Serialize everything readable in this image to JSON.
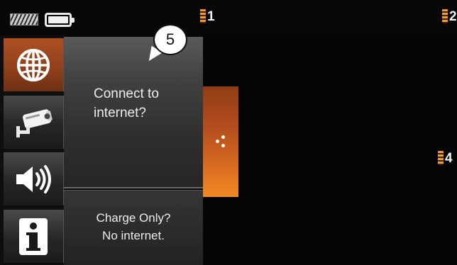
{
  "status_bar": {
    "signal_icon": "signal-strength-icon",
    "battery_icon": "battery-full-icon"
  },
  "channels": [
    {
      "number": "1"
    },
    {
      "number": "2"
    },
    {
      "number": "4"
    }
  ],
  "side_nav": {
    "items": [
      {
        "icon": "globe-icon",
        "active": true
      },
      {
        "icon": "security-camera-icon",
        "active": false
      },
      {
        "icon": "speaker-volume-icon",
        "active": false
      },
      {
        "icon": "info-icon",
        "active": false
      }
    ]
  },
  "dialog": {
    "callout_number": "5",
    "internet_option": {
      "line1": "Connect to",
      "line2": "internet?"
    },
    "charge_option": {
      "line1": "Charge Only?",
      "line2": "No internet."
    }
  },
  "pull_tab": {
    "icon": "share-dots-icon"
  },
  "colors": {
    "accent_orange": "#e07420",
    "active_nav": "#9a451d",
    "background": "#050505"
  }
}
